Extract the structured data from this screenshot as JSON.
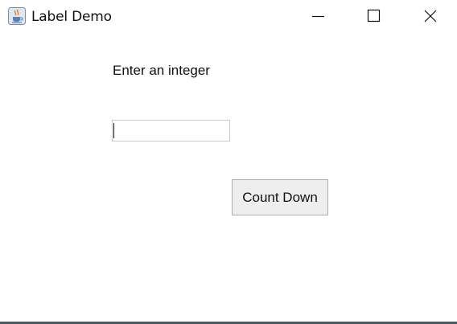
{
  "window": {
    "title": "Label Demo",
    "app_icon": "java-coffee-cup-icon",
    "controls": [
      "minimize-icon",
      "maximize-icon",
      "close-icon"
    ]
  },
  "form": {
    "prompt_label": "Enter an integer",
    "input_value": "",
    "button_label": "Count Down"
  },
  "colors": {
    "background": "#ffffff",
    "button_face": "#eeeeee",
    "button_border": "#adadad",
    "input_border": "#c9c9c9",
    "window_edge": "#4a5a5e"
  }
}
